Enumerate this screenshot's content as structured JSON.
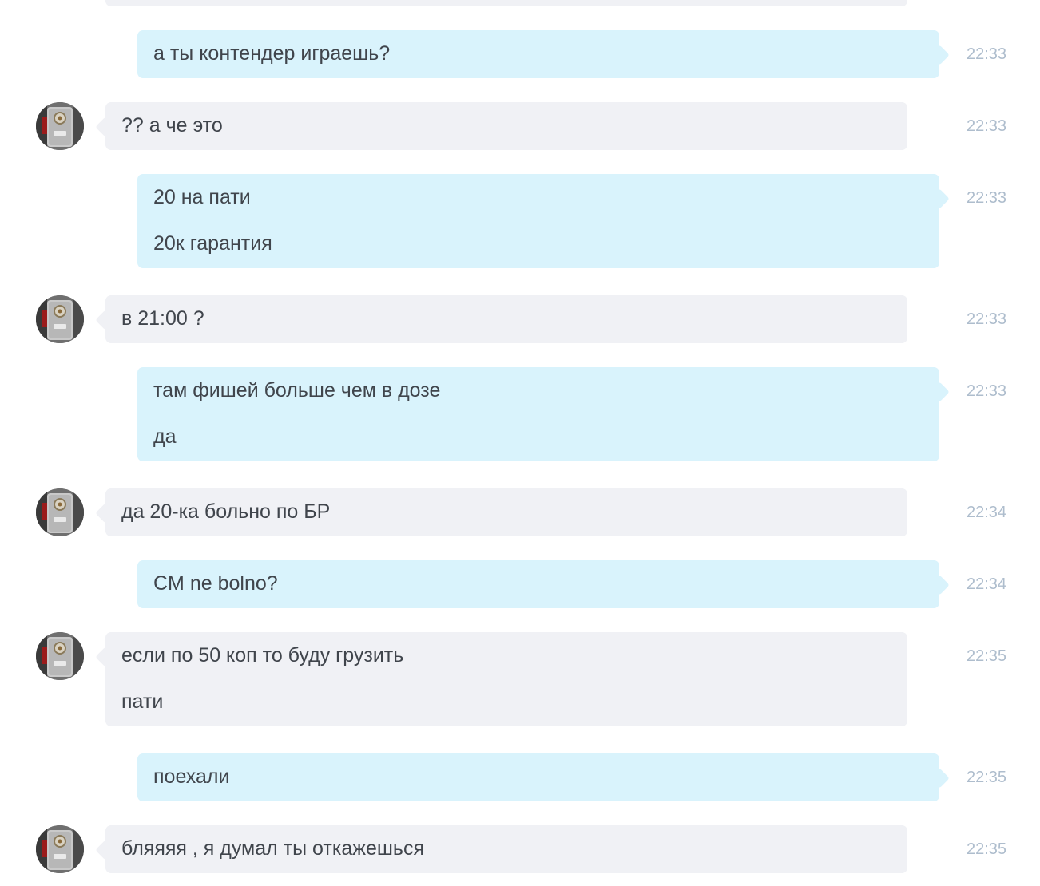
{
  "messages": [
    {
      "dir": "out",
      "time": "22:33",
      "lines": [
        "а ты контендер играешь?"
      ]
    },
    {
      "dir": "in",
      "time": "22:33",
      "lines": [
        "?? а че это"
      ]
    },
    {
      "dir": "out",
      "time": "22:33",
      "lines": [
        "20 на пати",
        "20к гарантия"
      ]
    },
    {
      "dir": "in",
      "time": "22:33",
      "lines": [
        "в 21:00 ?"
      ]
    },
    {
      "dir": "out",
      "time": "22:33",
      "lines": [
        "там фишей больше чем в дозе",
        "да"
      ]
    },
    {
      "dir": "in",
      "time": "22:34",
      "lines": [
        "да 20-ка больно по БР"
      ]
    },
    {
      "dir": "out",
      "time": "22:34",
      "lines": [
        "CM ne bolno?"
      ]
    },
    {
      "dir": "in",
      "time": "22:35",
      "lines": [
        "если по 50 коп то буду грузить",
        "пати"
      ]
    },
    {
      "dir": "out",
      "time": "22:35",
      "lines": [
        "поехали"
      ]
    },
    {
      "dir": "in",
      "time": "22:35",
      "lines": [
        "бляяяя , я думал ты откажешься"
      ]
    }
  ],
  "colors": {
    "incoming_bubble": "#f0f1f5",
    "outgoing_bubble": "#d9f3fc",
    "text": "#40454c",
    "time": "#aebdcd"
  },
  "icons": {
    "avatar": "avatar-photo-icon"
  }
}
